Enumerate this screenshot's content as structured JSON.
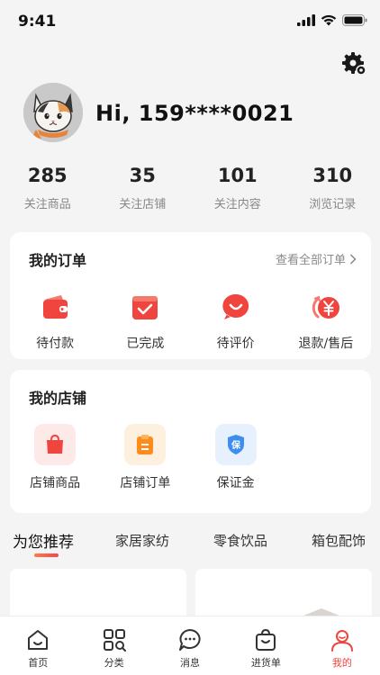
{
  "status": {
    "time": "9:41"
  },
  "user": {
    "greeting": "Hi, 159****0021"
  },
  "stats": [
    {
      "value": "285",
      "label": "关注商品"
    },
    {
      "value": "35",
      "label": "关注店铺"
    },
    {
      "value": "101",
      "label": "关注内容"
    },
    {
      "value": "310",
      "label": "浏览记录"
    }
  ],
  "orders": {
    "title": "我的订单",
    "view_all": "查看全部订单",
    "items": [
      {
        "label": "待付款",
        "icon": "wallet-icon"
      },
      {
        "label": "已完成",
        "icon": "check-box-icon"
      },
      {
        "label": "待评价",
        "icon": "smile-chat-icon"
      },
      {
        "label": "退款/售后",
        "icon": "refund-yen-icon"
      }
    ]
  },
  "shop": {
    "title": "我的店铺",
    "items": [
      {
        "label": "店铺商品",
        "icon": "shopping-bag-icon"
      },
      {
        "label": "店铺订单",
        "icon": "clipboard-icon"
      },
      {
        "label": "保证金",
        "icon": "shield-bao-icon",
        "badge_text": "保"
      }
    ]
  },
  "tabs": [
    {
      "label": "为您推荐",
      "active": true
    },
    {
      "label": "家居家纺"
    },
    {
      "label": "零食饮品"
    },
    {
      "label": "箱包配饰"
    }
  ],
  "nav": [
    {
      "label": "首页",
      "icon": "home-icon"
    },
    {
      "label": "分类",
      "icon": "category-icon"
    },
    {
      "label": "消息",
      "icon": "message-icon"
    },
    {
      "label": "进货单",
      "icon": "cart-bag-icon"
    },
    {
      "label": "我的",
      "icon": "profile-icon",
      "active": true
    }
  ],
  "colors": {
    "accent": "#f0443e",
    "orange": "#ff8c1a",
    "blue": "#3d8ef0"
  }
}
